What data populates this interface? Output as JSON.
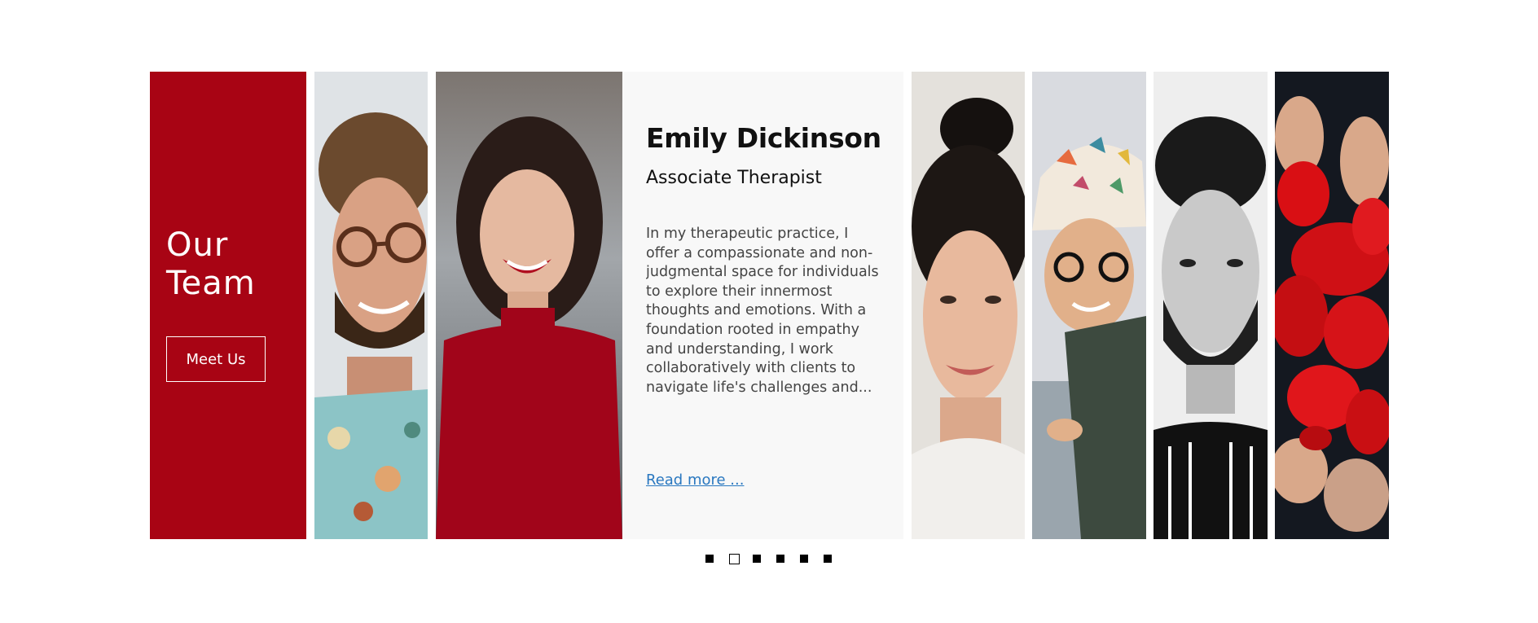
{
  "intro": {
    "title": "Our Team",
    "button_label": "Meet Us"
  },
  "featured": {
    "name": "Emily Dickinson",
    "role": "Associate Therapist",
    "bio": "In my therapeutic practice, I offer a compassionate and non-judgmental space for individuals to explore their innermost thoughts and emotions. With a foundation rooted in empathy and understanding, I work collaboratively with clients to navigate life's challenges and...",
    "read_more": "Read more ..."
  },
  "colors": {
    "brand_red": "#a80414",
    "link_blue": "#2a78c0",
    "card_bg": "#f8f8f8"
  },
  "pagination": {
    "count": 6,
    "active_index": 1
  },
  "photos": [
    {
      "icon": "portrait-man-glasses-curly-hair"
    },
    {
      "icon": "portrait-woman-red-top-smiling"
    },
    {
      "icon": "portrait-woman-hair-bun-smiling"
    },
    {
      "icon": "portrait-woman-bucket-hat-glasses"
    },
    {
      "icon": "portrait-man-beard-bw"
    },
    {
      "icon": "red-painted-hands"
    }
  ]
}
